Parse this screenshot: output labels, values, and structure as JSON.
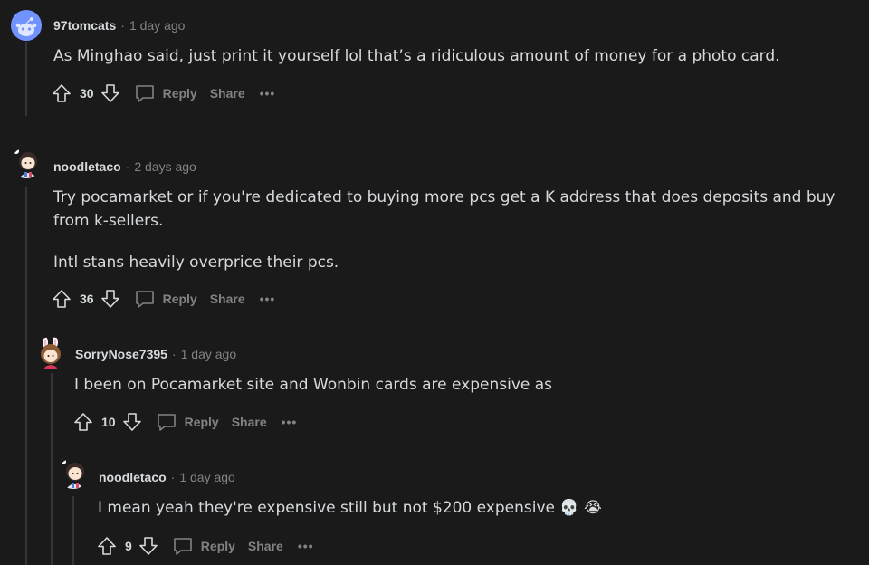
{
  "comments": [
    {
      "username": "97tomcats",
      "timestamp": "1 day ago",
      "body": [
        "As Minghao said, just print it yourself lol that’s a ridiculous amount of money for a photo card."
      ],
      "score": "30",
      "reply_label": "Reply",
      "share_label": "Share",
      "more_label": "•••",
      "avatar": "reddit-snoo-avatar"
    },
    {
      "username": "noodletaco",
      "timestamp": "2 days ago",
      "body": [
        "Try pocamarket or if you're dedicated to buying more pcs get a K address that does deposits and buy from k-sellers.",
        "Intl stans heavily overprice their pcs."
      ],
      "score": "36",
      "reply_label": "Reply",
      "share_label": "Share",
      "more_label": "•••",
      "avatar": "chibi-character-avatar"
    },
    {
      "username": "SorryNose7395",
      "timestamp": "1 day ago",
      "body": [
        "I been on Pocamarket site and Wonbin cards are expensive as"
      ],
      "score": "10",
      "reply_label": "Reply",
      "share_label": "Share",
      "more_label": "•••",
      "avatar": "bunny-ear-character-avatar"
    },
    {
      "username": "noodletaco",
      "timestamp": "1 day ago",
      "body": [
        "I mean yeah they're expensive still but not $200 expensive"
      ],
      "emojis": [
        "💀",
        "😭"
      ],
      "score": "9",
      "reply_label": "Reply",
      "share_label": "Share",
      "more_label": "•••",
      "avatar": "chibi-character-avatar"
    }
  ],
  "colors": {
    "background": "#1a1a1b",
    "text": "#d7dadc",
    "muted": "#818384",
    "thread_line": "#343536",
    "snoo_blue": "#7193ff"
  }
}
